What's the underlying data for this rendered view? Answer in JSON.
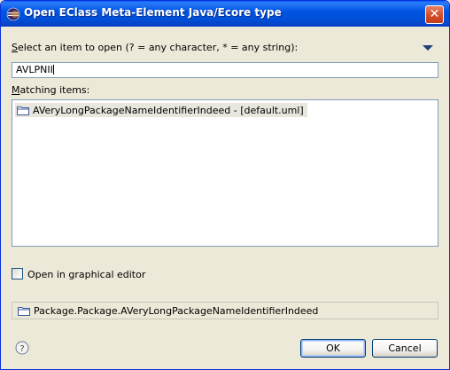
{
  "window": {
    "title": "Open EClass Meta-Element Java/Ecore type",
    "close_glyph": "✕",
    "icon": "eclipse-icon"
  },
  "filter": {
    "label_mnemonic": "S",
    "label_rest": "elect an item to open (? = any character, * = any string):",
    "value": "AVLPNII",
    "menu_icon": "triangle-down-icon"
  },
  "matching": {
    "label_mnemonic": "M",
    "label_rest": "atching items:",
    "items": [
      {
        "icon": "folder-icon",
        "label": "AVeryLongPackageNameIdentifierIndeed - [default.uml]"
      }
    ]
  },
  "graphical_editor": {
    "label": "Open in graphical editor",
    "checked": false
  },
  "status": {
    "icon": "folder-icon",
    "text": "Package.Package.AVeryLongPackageNameIdentifierIndeed"
  },
  "buttons": {
    "ok": "OK",
    "cancel": "Cancel",
    "help_icon": "help-icon"
  },
  "colors": {
    "titlebar": "#0054e3",
    "dialog_bg": "#ece9d8",
    "selection_bg": "#e8e6dd"
  }
}
